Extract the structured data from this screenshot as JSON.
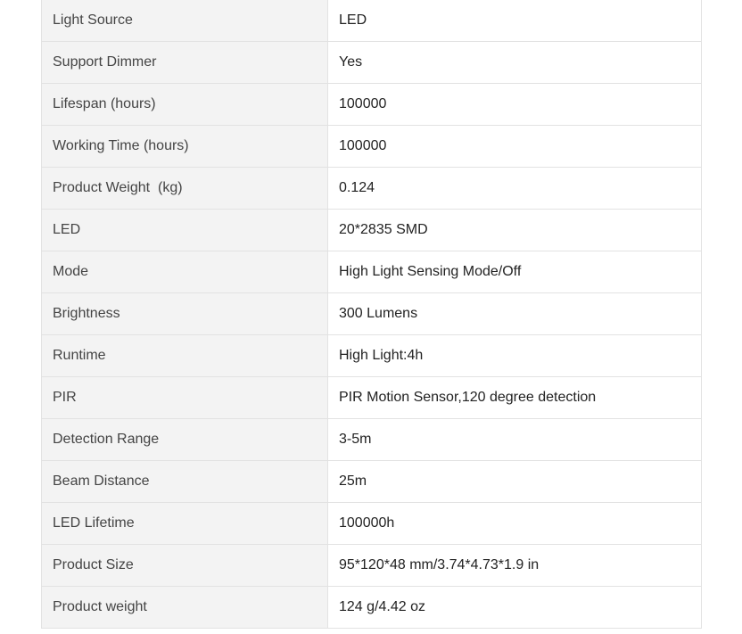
{
  "spec_table": {
    "rows": [
      {
        "label": "Light Source",
        "value": "LED"
      },
      {
        "label": "Support Dimmer",
        "value": "Yes"
      },
      {
        "label": "Lifespan (hours)",
        "value": "100000"
      },
      {
        "label": "Working Time (hours)",
        "value": "100000"
      },
      {
        "label": "Product Weight  (kg)",
        "value": "0.124"
      },
      {
        "label": "LED",
        "value": "20*2835 SMD"
      },
      {
        "label": "Mode",
        "value": "High Light Sensing Mode/Off"
      },
      {
        "label": "Brightness",
        "value": "300 Lumens"
      },
      {
        "label": "Runtime",
        "value": "High Light:4h"
      },
      {
        "label": "PIR",
        "value": "PIR Motion Sensor,120 degree detection"
      },
      {
        "label": "Detection Range",
        "value": "3-5m"
      },
      {
        "label": "Beam Distance",
        "value": "25m"
      },
      {
        "label": "LED Lifetime",
        "value": "100000h"
      },
      {
        "label": "Product Size",
        "value": "95*120*48 mm/3.74*4.73*1.9 in"
      },
      {
        "label": "Product weight",
        "value": "124 g/4.42 oz"
      }
    ]
  }
}
